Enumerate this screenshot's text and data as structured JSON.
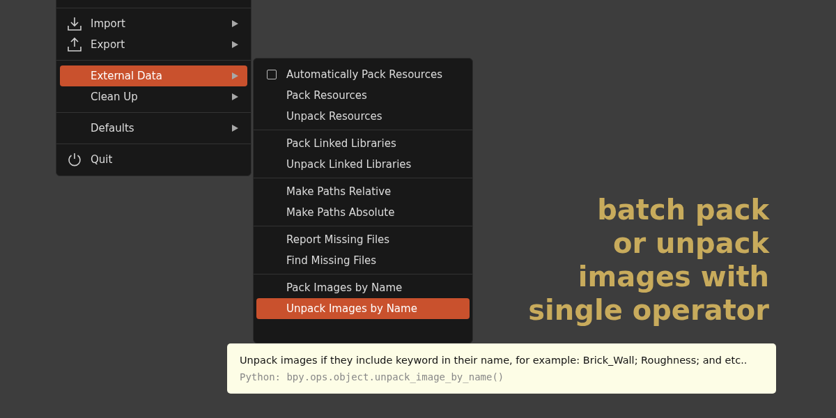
{
  "file_menu": {
    "sections": [
      {
        "items": [
          {
            "label": "Import",
            "selected": false,
            "has_submenu": true
          },
          {
            "label": "Export",
            "selected": false,
            "has_submenu": true
          }
        ]
      },
      {
        "items": [
          {
            "label": "External Data",
            "selected": true,
            "has_submenu": true
          },
          {
            "label": "Clean Up",
            "selected": false,
            "has_submenu": true
          }
        ]
      },
      {
        "items": [
          {
            "label": "Defaults",
            "selected": false,
            "has_submenu": true
          }
        ]
      },
      {
        "items": [
          {
            "label": "Quit",
            "selected": false,
            "has_submenu": false
          }
        ]
      }
    ]
  },
  "external_data_menu": {
    "sections": [
      {
        "items": [
          {
            "label": "Automatically Pack Resources",
            "kind": "checkbox",
            "checked": false,
            "selected": false
          },
          {
            "label": "Pack Resources",
            "kind": "action",
            "selected": false
          },
          {
            "label": "Unpack Resources",
            "kind": "action",
            "selected": false
          }
        ]
      },
      {
        "items": [
          {
            "label": "Pack Linked Libraries",
            "kind": "action",
            "selected": false
          },
          {
            "label": "Unpack Linked Libraries",
            "kind": "action",
            "selected": false
          }
        ]
      },
      {
        "items": [
          {
            "label": "Make Paths Relative",
            "kind": "action",
            "selected": false
          },
          {
            "label": "Make Paths Absolute",
            "kind": "action",
            "selected": false
          }
        ]
      },
      {
        "items": [
          {
            "label": "Report Missing Files",
            "kind": "action",
            "selected": false
          },
          {
            "label": "Find Missing Files",
            "kind": "action",
            "selected": false
          }
        ]
      },
      {
        "items": [
          {
            "label": "Pack Images by Name",
            "kind": "action",
            "selected": false
          },
          {
            "label": "Unpack Images by Name",
            "kind": "action",
            "selected": true
          }
        ]
      }
    ]
  },
  "tooltip": {
    "description": "Unpack images if they include keyword in their name, for example: Brick_Wall; Roughness; and etc..",
    "python": "Python: bpy.ops.object.unpack_image_by_name()"
  },
  "headline": [
    "batch pack",
    "or unpack",
    "images with",
    "single operator"
  ]
}
